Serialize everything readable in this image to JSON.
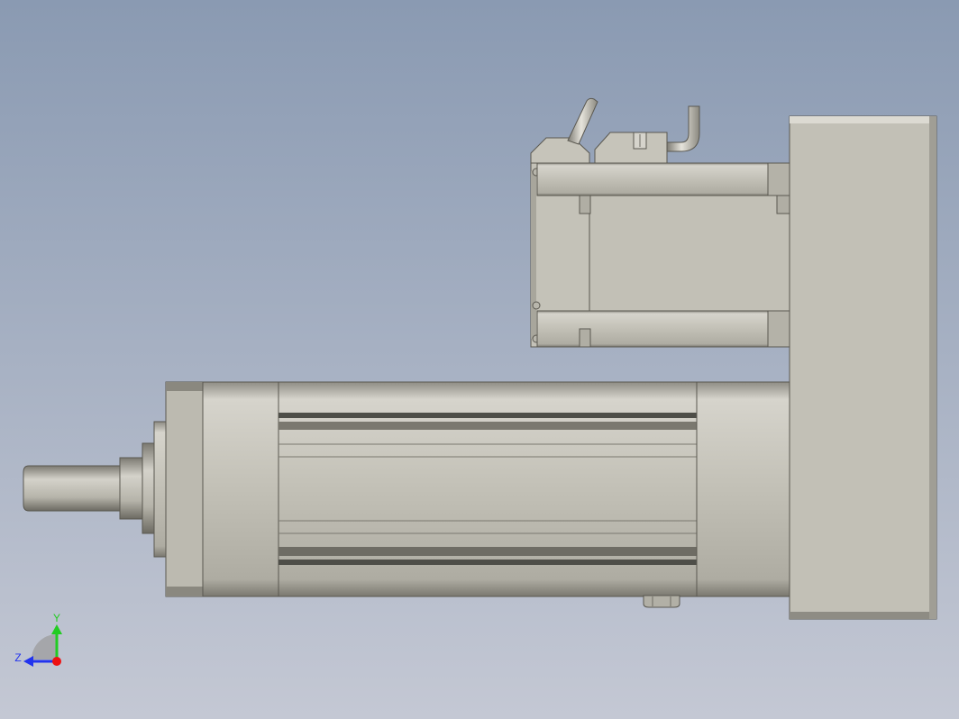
{
  "viewport": {
    "background_top": "#8a9ab2",
    "background_bottom": "#c4c8d4"
  },
  "model": {
    "body_color": "#c0beb4",
    "shadow_color": "#6e6e66",
    "edge_color": "#4a4a44",
    "highlight_color": "#dedcd4"
  },
  "triad": {
    "y_label": "Y",
    "z_label": "Z",
    "y_color": "#22cc22",
    "z_color": "#2233ee",
    "x_color": "#ee1111"
  }
}
